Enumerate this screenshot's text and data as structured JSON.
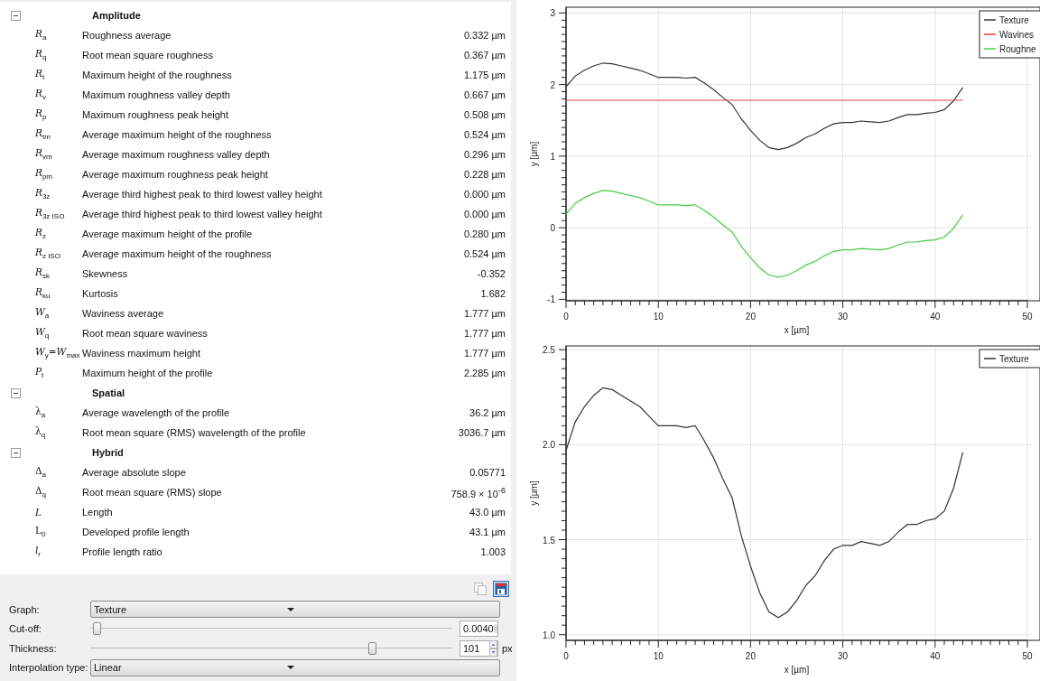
{
  "parameters": {
    "groups": [
      {
        "title": "Amplitude",
        "expanded": true,
        "rows": [
          {
            "symbol": "*R*$_{a}$",
            "name": "Roughness average",
            "value": "0.332 µm"
          },
          {
            "symbol": "*R*$_{q}$",
            "name": "Root mean square roughness",
            "value": "0.367 µm"
          },
          {
            "symbol": "*R*$_{t}$",
            "name": "Maximum height of the roughness",
            "value": "1.175 µm"
          },
          {
            "symbol": "*R*$_{v}$",
            "name": "Maximum roughness valley depth",
            "value": "0.667 µm"
          },
          {
            "symbol": "*R*$_{p}$",
            "name": "Maximum roughness peak height",
            "value": "0.508 µm"
          },
          {
            "symbol": "*R*$_{tm}$",
            "name": "Average maximum height of the roughness",
            "value": "0.524 µm"
          },
          {
            "symbol": "*R*$_{vm}$",
            "name": "Average maximum roughness valley depth",
            "value": "0.296 µm"
          },
          {
            "symbol": "*R*$_{pm}$",
            "name": "Average maximum roughness peak height",
            "value": "0.228 µm"
          },
          {
            "symbol": "*R*$_{3z}$",
            "name": "Average third highest peak to third lowest valley height",
            "value": "0.000 µm"
          },
          {
            "symbol": "*R*$_{3z ISO}$",
            "name": "Average third highest peak to third lowest valley height",
            "value": "0.000 µm"
          },
          {
            "symbol": "*R*$_{z}$",
            "name": "Average maximum height of the profile",
            "value": "0.280 µm"
          },
          {
            "symbol": "*R*$_{z ISO}$",
            "name": "Average maximum height of the roughness",
            "value": "0.524 µm"
          },
          {
            "symbol": "*R*$_{sk}$",
            "name": "Skewness",
            "value": "-0.352"
          },
          {
            "symbol": "*R*$_{ku}$",
            "name": "Kurtosis",
            "value": "1.682"
          },
          {
            "symbol": "*W*$_{a}$",
            "name": "Waviness average",
            "value": "1.777 µm"
          },
          {
            "symbol": "*W*$_{q}$",
            "name": "Root mean square waviness",
            "value": "1.777 µm"
          },
          {
            "symbol": "*W*$_{y}$=*W*$_{max}$",
            "name": "Waviness maximum height",
            "value": "1.777 µm"
          },
          {
            "symbol": "*P*$_{t}$",
            "name": "Maximum height of the profile",
            "value": "2.285 µm"
          }
        ]
      },
      {
        "title": "Spatial",
        "expanded": true,
        "rows": [
          {
            "symbol": "λ$_{a}$",
            "name": "Average wavelength of the profile",
            "value": "36.2 µm"
          },
          {
            "symbol": "λ$_{q}$",
            "name": "Root mean square (RMS) wavelength of the profile",
            "value": "3036.7 µm"
          }
        ]
      },
      {
        "title": "Hybrid",
        "expanded": true,
        "rows": [
          {
            "symbol": "Δ$_{a}$",
            "name": "Average absolute slope",
            "value": "0.05771"
          },
          {
            "symbol": "Δ$_{q}$",
            "name": "Root mean square (RMS) slope",
            "value": "758.9 × 10$^{-6}$"
          },
          {
            "symbol": "*L*",
            "name": "Length",
            "value": "43.0 µm"
          },
          {
            "symbol": "L$_{0}$",
            "name": "Developed profile length",
            "value": "43.1 µm"
          },
          {
            "symbol": "*l*$_{r}$",
            "name": "Profile length ratio",
            "value": "1.003"
          }
        ]
      }
    ]
  },
  "toolbar": [
    {
      "kind": "copy",
      "disabled": true
    },
    {
      "kind": "save",
      "disabled": false
    }
  ],
  "controls": [
    {
      "kind": "dropdown",
      "label": "Graph:",
      "value": "Texture"
    },
    {
      "kind": "slider",
      "label": "Cut-off:",
      "level": 0.02,
      "value": "0.0040"
    },
    {
      "kind": "slider",
      "label": "Thickness:",
      "level": 0.78,
      "value": "101",
      "unit": "px"
    },
    {
      "kind": "dropdown",
      "label": "Interpolation type:",
      "value": "Linear"
    }
  ],
  "charts": [
    {
      "chart_data": {
        "type": "line",
        "grid": true,
        "legend": true,
        "xlabel": "x [µm]",
        "ylabel": "y [µm]",
        "xlim": [
          0,
          50
        ],
        "ylim": [
          -1.02,
          3.08
        ],
        "xticks": [
          0,
          10,
          20,
          30,
          40,
          50
        ],
        "yticks": [
          -1,
          0,
          1,
          2,
          3
        ],
        "x": [
          0,
          1,
          2,
          3,
          4,
          5,
          6,
          7,
          8,
          9,
          10,
          11,
          12,
          13,
          14,
          15,
          16,
          17,
          18,
          19,
          20,
          21,
          22,
          23,
          24,
          25,
          26,
          27,
          28,
          29,
          30,
          31,
          32,
          33,
          34,
          35,
          36,
          37,
          38,
          39,
          40,
          41,
          42,
          43
        ],
        "series": [
          {
            "name": "Texture",
            "color": "#333333",
            "values": [
              1.97,
              2.12,
              2.2,
              2.26,
              2.3,
              2.29,
              2.26,
              2.23,
              2.2,
              2.15,
              2.1,
              2.1,
              2.1,
              2.09,
              2.1,
              2.02,
              1.93,
              1.82,
              1.72,
              1.52,
              1.36,
              1.22,
              1.12,
              1.09,
              1.12,
              1.18,
              1.26,
              1.31,
              1.39,
              1.45,
              1.47,
              1.47,
              1.49,
              1.48,
              1.47,
              1.49,
              1.54,
              1.58,
              1.58,
              1.6,
              1.61,
              1.65,
              1.77,
              1.96
            ]
          },
          {
            "name": "Wavines",
            "color": "#e84040",
            "values": [
              1.78,
              1.78,
              1.78,
              1.78,
              1.78,
              1.78,
              1.78,
              1.78,
              1.78,
              1.78,
              1.78,
              1.78,
              1.78,
              1.78,
              1.78,
              1.78,
              1.78,
              1.78,
              1.78,
              1.78,
              1.78,
              1.78,
              1.78,
              1.78,
              1.78,
              1.78,
              1.78,
              1.78,
              1.78,
              1.78,
              1.78,
              1.78,
              1.78,
              1.78,
              1.78,
              1.78,
              1.78,
              1.78,
              1.78,
              1.78,
              1.78,
              1.78,
              1.78,
              1.78
            ]
          },
          {
            "name": "Roughne",
            "color": "#44cc44",
            "values": [
              0.19,
              0.34,
              0.42,
              0.48,
              0.52,
              0.51,
              0.48,
              0.45,
              0.42,
              0.37,
              0.32,
              0.32,
              0.32,
              0.31,
              0.32,
              0.24,
              0.15,
              0.04,
              -0.06,
              -0.26,
              -0.42,
              -0.56,
              -0.66,
              -0.69,
              -0.66,
              -0.6,
              -0.52,
              -0.47,
              -0.39,
              -0.33,
              -0.31,
              -0.31,
              -0.29,
              -0.3,
              -0.31,
              -0.29,
              -0.24,
              -0.2,
              -0.2,
              -0.18,
              -0.17,
              -0.13,
              -0.01,
              0.18
            ]
          }
        ]
      }
    },
    {
      "chart_data": {
        "type": "line",
        "grid": true,
        "legend": true,
        "xlabel": "x [µm]",
        "ylabel": "y [µm]",
        "xlim": [
          0,
          50
        ],
        "ylim": [
          0.97,
          2.52
        ],
        "xticks": [
          0,
          10,
          20,
          30,
          40,
          50
        ],
        "yticks": [
          {
            "value": 1,
            "label": "1.0"
          },
          {
            "value": 1.5,
            "label": "1.5"
          },
          {
            "value": 2,
            "label": "2.0"
          },
          {
            "value": 2.5,
            "label": "2.5"
          }
        ],
        "x": [
          0,
          1,
          2,
          3,
          4,
          5,
          6,
          7,
          8,
          9,
          10,
          11,
          12,
          13,
          14,
          15,
          16,
          17,
          18,
          19,
          20,
          21,
          22,
          23,
          24,
          25,
          26,
          27,
          28,
          29,
          30,
          31,
          32,
          33,
          34,
          35,
          36,
          37,
          38,
          39,
          40,
          41,
          42,
          43
        ],
        "series": [
          {
            "name": "Texture",
            "color": "#333333",
            "values": [
              1.97,
              2.12,
              2.2,
              2.26,
              2.3,
              2.29,
              2.26,
              2.23,
              2.2,
              2.15,
              2.1,
              2.1,
              2.1,
              2.09,
              2.1,
              2.02,
              1.93,
              1.82,
              1.72,
              1.52,
              1.36,
              1.22,
              1.12,
              1.09,
              1.12,
              1.18,
              1.26,
              1.31,
              1.39,
              1.45,
              1.47,
              1.47,
              1.49,
              1.48,
              1.47,
              1.49,
              1.54,
              1.58,
              1.58,
              1.6,
              1.61,
              1.65,
              1.77,
              1.96
            ]
          }
        ]
      }
    }
  ]
}
